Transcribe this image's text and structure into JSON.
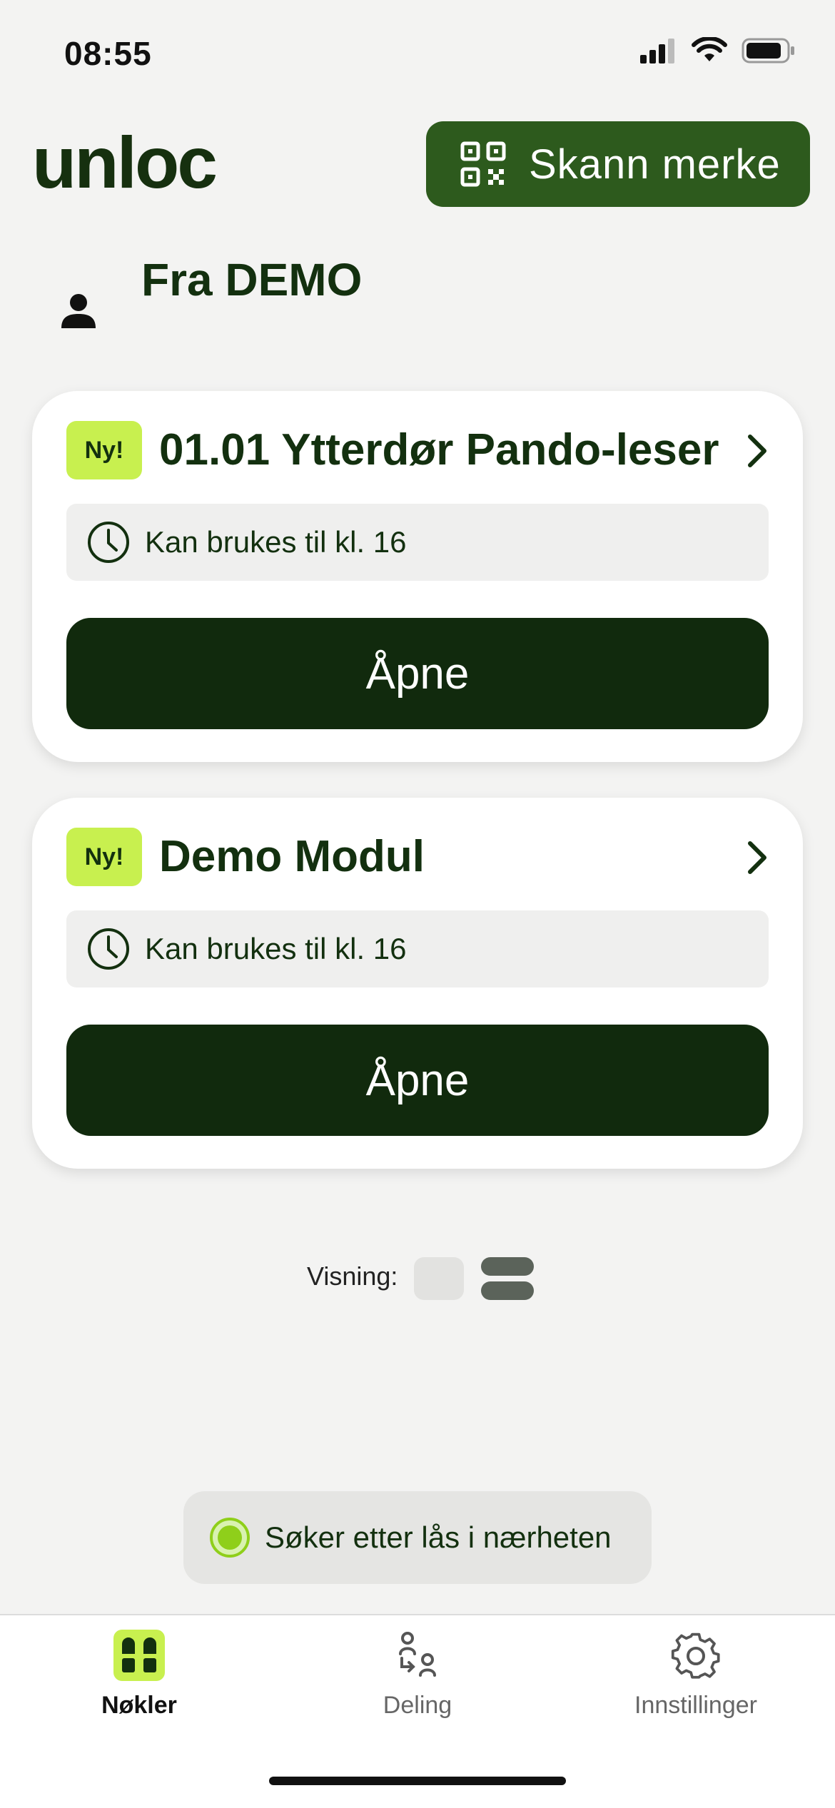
{
  "status": {
    "time": "08:55"
  },
  "header": {
    "logo": "unloc",
    "scan_button": "Skann merke"
  },
  "section": {
    "title": "Fra DEMO"
  },
  "cards": [
    {
      "badge": "Ny!",
      "title": "01.01 Ytterdør Pando-leser",
      "info": "Kan brukes til kl. 16",
      "button": "Åpne"
    },
    {
      "badge": "Ny!",
      "title": "Demo Modul",
      "info": "Kan brukes til kl. 16",
      "button": "Åpne"
    }
  ],
  "view": {
    "label": "Visning:"
  },
  "scan_status": {
    "text": "Søker etter lås i nærheten"
  },
  "tabbar": {
    "tabs": [
      {
        "label": "Nøkler",
        "icon": "keys-icon",
        "active": true
      },
      {
        "label": "Deling",
        "icon": "sharing-icon",
        "active": false
      },
      {
        "label": "Innstillinger",
        "icon": "gear-icon",
        "active": false
      }
    ]
  },
  "colors": {
    "brand_green": "#2d5a1d",
    "dark_button": "#112a0d",
    "badge_lime": "#c8f04f",
    "scan_dot": "#8fcf1a"
  }
}
